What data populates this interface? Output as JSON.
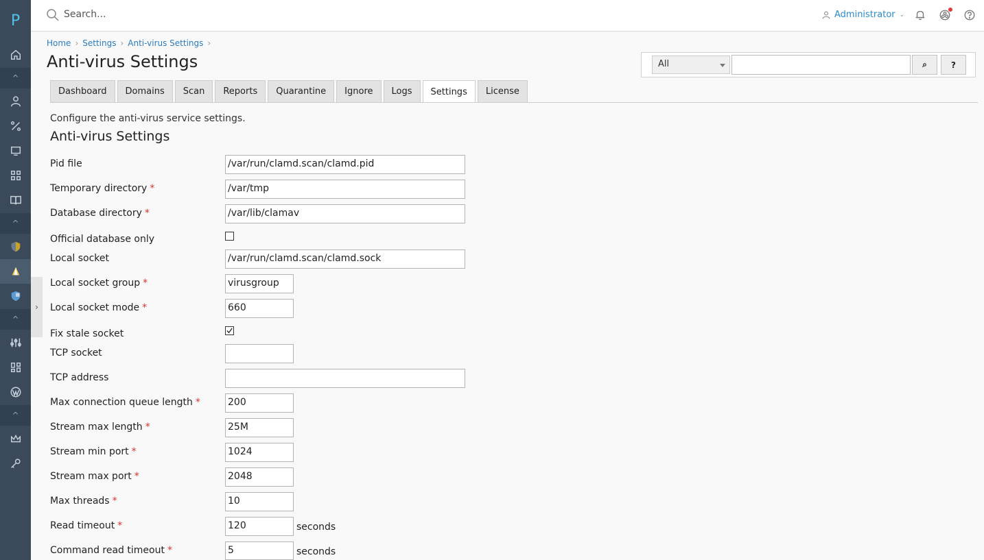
{
  "sidebar": {
    "logo": "P",
    "items": [
      {
        "name": "home-icon"
      },
      {
        "name": "users-icon"
      },
      {
        "name": "percent-icon"
      },
      {
        "name": "monitor-icon"
      },
      {
        "name": "apps-icon"
      },
      {
        "name": "book-icon"
      },
      {
        "name": "shield-gold-icon"
      },
      {
        "name": "antivirus-icon"
      },
      {
        "name": "shield-blue-icon"
      },
      {
        "name": "sliders-icon"
      },
      {
        "name": "widgets-icon"
      },
      {
        "name": "wordpress-icon"
      },
      {
        "name": "crown-icon"
      },
      {
        "name": "key-icon"
      }
    ]
  },
  "header": {
    "search_placeholder": "Search...",
    "user": "Administrator"
  },
  "breadcrumb": [
    "Home",
    "Settings",
    "Anti-virus Settings"
  ],
  "page_title": "Anti-virus Settings",
  "search_panel": {
    "filter": "All",
    "query": "",
    "search_button": "⌕",
    "help_button": "?"
  },
  "tabs": [
    "Dashboard",
    "Domains",
    "Scan",
    "Reports",
    "Quarantine",
    "Ignore",
    "Logs",
    "Settings",
    "License"
  ],
  "active_tab": "Settings",
  "description": "Configure the anti-virus service settings.",
  "section_title": "Anti-virus Settings",
  "fields": {
    "pid_file": {
      "label": "Pid file",
      "value": "/var/run/clamd.scan/clamd.pid"
    },
    "temp_dir": {
      "label": "Temporary directory",
      "value": "/var/tmp"
    },
    "db_dir": {
      "label": "Database directory",
      "value": "/var/lib/clamav"
    },
    "official_db": {
      "label": "Official database only",
      "checked": false
    },
    "local_socket": {
      "label": "Local socket",
      "value": "/var/run/clamd.scan/clamd.sock"
    },
    "socket_group": {
      "label": "Local socket group",
      "value": "virusgroup"
    },
    "socket_mode": {
      "label": "Local socket mode",
      "value": "660"
    },
    "fix_stale": {
      "label": "Fix stale socket",
      "checked": true
    },
    "tcp_socket": {
      "label": "TCP socket",
      "value": ""
    },
    "tcp_address": {
      "label": "TCP address",
      "value": ""
    },
    "max_queue": {
      "label": "Max connection queue length",
      "value": "200"
    },
    "stream_max_len": {
      "label": "Stream max length",
      "value": "25M"
    },
    "stream_min_port": {
      "label": "Stream min port",
      "value": "1024"
    },
    "stream_max_port": {
      "label": "Stream max port",
      "value": "2048"
    },
    "max_threads": {
      "label": "Max threads",
      "value": "10"
    },
    "read_timeout": {
      "label": "Read timeout",
      "value": "120",
      "unit": "seconds"
    },
    "cmd_read_timeout": {
      "label": "Command read timeout",
      "value": "5",
      "unit": "seconds"
    }
  }
}
